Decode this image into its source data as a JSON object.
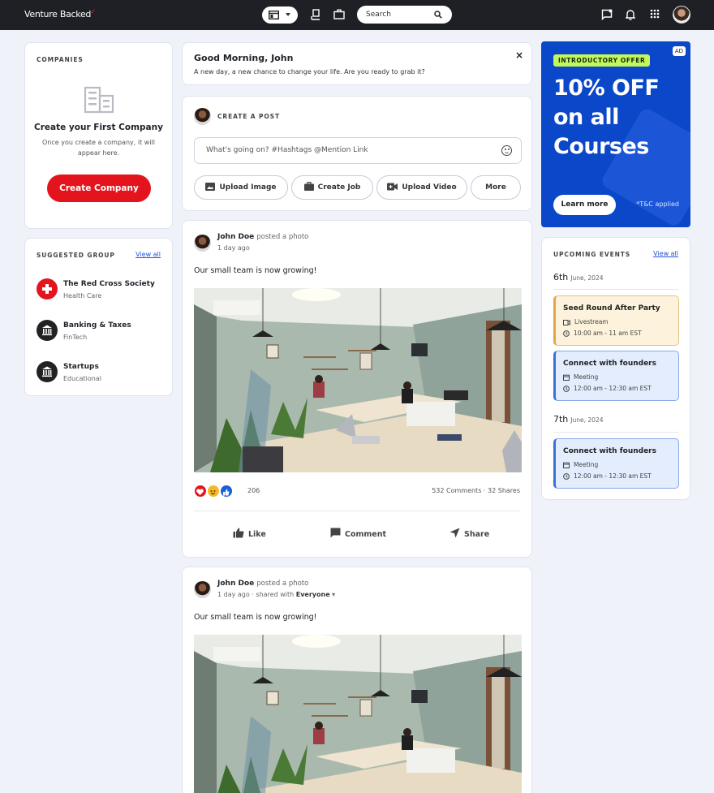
{
  "header": {
    "logo_text": "Venture Backed",
    "logo_mark": "✓",
    "search_placeholder": "Search"
  },
  "companies": {
    "label": "COMPANIES",
    "title": "Create your First Company",
    "description": "Once you create a company, it will appear here.",
    "button": "Create Company"
  },
  "groups": {
    "label": "SUGGESTED GROUP",
    "view_all": "View all",
    "items": [
      {
        "name": "The Red Cross Society",
        "category": "Health Care",
        "icon": "red-cross-icon",
        "color": "#e4141e"
      },
      {
        "name": "Banking & Taxes",
        "category": "FinTech",
        "icon": "bank-icon",
        "color": "#222222"
      },
      {
        "name": "Startups",
        "category": "Educational",
        "icon": "bank-icon",
        "color": "#222222"
      }
    ]
  },
  "greeting": {
    "title": "Good Morning, John",
    "subtitle": "A new day, a new chance to change your life. Are you ready to grab it?",
    "close": "×"
  },
  "create_post": {
    "label": "CREATE A POST",
    "placeholder": "What's going on? #Hashtags @Mention Link",
    "buttons": [
      "Upload Image",
      "Create Job",
      "Upload Video",
      "More"
    ]
  },
  "posts": [
    {
      "author": "John Doe",
      "action": "posted a photo",
      "time": "1 day ago",
      "text": "Our small team is now growing!",
      "reaction_count": "206",
      "comments": "532 Comments",
      "shares": "32 Shares",
      "actions": [
        "Like",
        "Comment",
        "Share"
      ]
    },
    {
      "author": "John Doe",
      "action": "posted a photo",
      "time": "1 day ago",
      "shared_with_prefix": "shared with",
      "shared_with": "Everyone",
      "text": "Our small team is now growing!"
    }
  ],
  "ad": {
    "tag": "INTRODUCTORY OFFER",
    "badge": "AD",
    "headline_1": "10% OFF",
    "headline_2": "on all",
    "headline_3": "Courses",
    "button": "Learn more",
    "terms": "*T&C applied"
  },
  "events": {
    "label": "UPCOMING EVENTS",
    "view_all": "View all",
    "days": [
      {
        "day": "6th",
        "month": "June, 2024",
        "items": [
          {
            "title": "Seed Round After Party",
            "type": "Livestream",
            "time": "10:00 am - 11 am EST",
            "style": "yellow"
          },
          {
            "title": "Connect with founders",
            "type": "Meeting",
            "time": "12:00 am - 12:30 am EST",
            "style": "blue"
          }
        ]
      },
      {
        "day": "7th",
        "month": "June, 2024",
        "items": [
          {
            "title": "Connect with founders",
            "type": "Meeting",
            "time": "12:00 am - 12:30 am EST",
            "style": "blue"
          }
        ]
      }
    ]
  }
}
